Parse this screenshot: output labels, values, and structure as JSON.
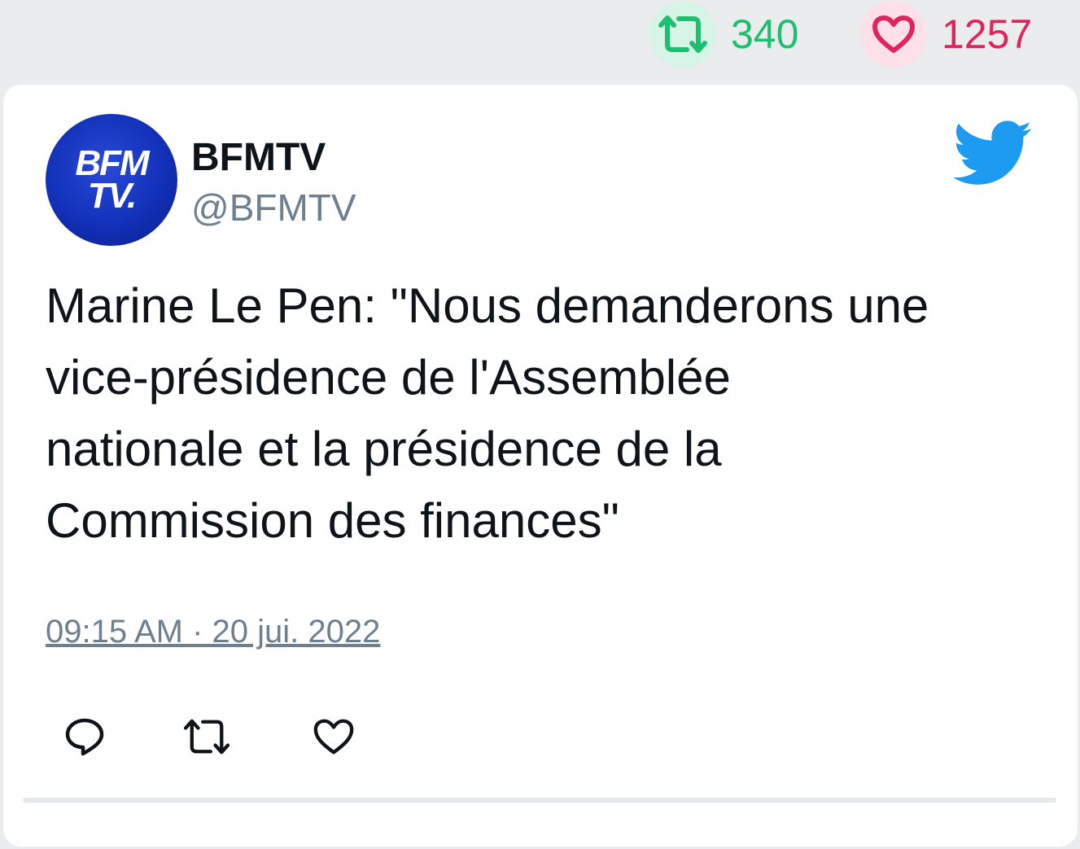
{
  "stats": {
    "retweet_count": "340",
    "like_count": "1257",
    "retweet_color": "#1fbf72",
    "like_color": "#e0245e",
    "retweet_icon": "retweet-icon",
    "like_icon": "heart-icon"
  },
  "tweet": {
    "avatar_line1": "BFM",
    "avatar_line2": "TV.",
    "display_name": "BFMTV",
    "handle": "@BFMTV",
    "platform_icon": "twitter-bird-icon",
    "text": "Marine Le Pen: \"Nous demanderons une\nvice-présidence de l'Assemblée\nnationale et la présidence de la\nCommission des finances\"",
    "timestamp": "09:15 AM · 20 jui. 2022",
    "accent_color": "#1d9bf0"
  },
  "actions": {
    "reply_icon": "reply-icon",
    "retweet_icon": "retweet-icon",
    "like_icon": "heart-icon"
  }
}
